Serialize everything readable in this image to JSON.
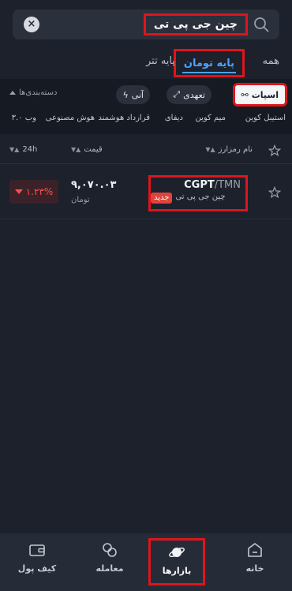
{
  "search": {
    "query": "چین جی پی تی"
  },
  "tabs": {
    "all": "همه",
    "toman": "پایه تومان",
    "tether": "پایه تتر"
  },
  "filters": {
    "spot": "اسپات",
    "margin": "تعهدی",
    "instant": "آنی",
    "categories_label": "دسته‌بندی‌ها",
    "categories": [
      "استیبل کوین",
      "میم کوین",
      "دیفای",
      "قرارداد هوشمند",
      "هوش مصنوعی",
      "وب ۳.۰"
    ]
  },
  "table": {
    "col_name": "نام رمزارز",
    "col_price": "قیمت",
    "col_change": "24h"
  },
  "row": {
    "base": "CGPT",
    "quote": "/TMN",
    "name_fa": "چین جی پی تی",
    "new_badge": "جدید",
    "price": "۹,۰۷۰.۰۳",
    "price_unit": "تومان",
    "change": "۱.۲۳%"
  },
  "bottom_nav": {
    "home": "خانه",
    "markets": "بازارها",
    "trade": "معامله",
    "wallet": "کیف پول"
  },
  "colors": {
    "accent": "#4aa3ff",
    "negative": "#ff4d4f",
    "highlight": "#e0141b",
    "background": "#1c212c"
  }
}
